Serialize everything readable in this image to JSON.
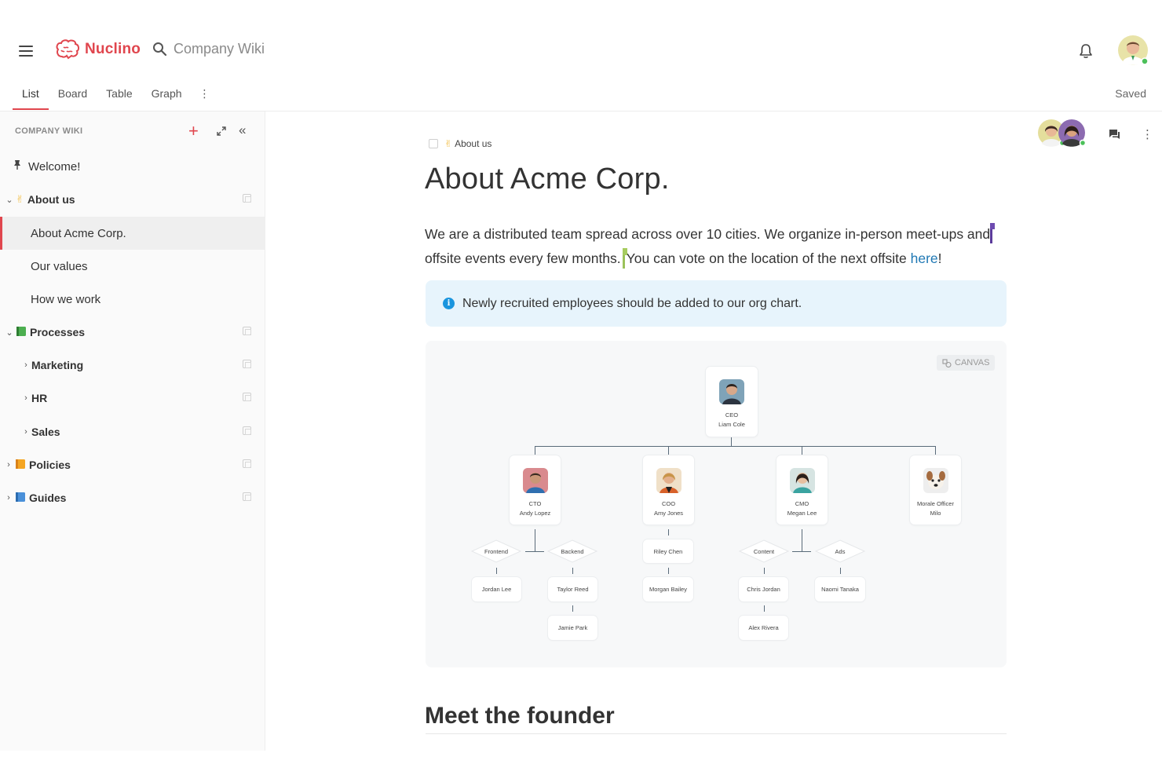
{
  "app": {
    "name": "Nuclino",
    "brand_color": "#e0464e"
  },
  "search": {
    "placeholder": "Company Wiki"
  },
  "tabs": [
    {
      "label": "List",
      "active": true
    },
    {
      "label": "Board",
      "active": false
    },
    {
      "label": "Table",
      "active": false
    },
    {
      "label": "Graph",
      "active": false
    }
  ],
  "tab_more": "⋮",
  "status": {
    "saved": "Saved"
  },
  "sidebar": {
    "header": "COMPANY WIKI",
    "items": [
      {
        "label": "Welcome!",
        "icon": "pin-icon"
      },
      {
        "label": "About us",
        "emoji": "✌",
        "expanded": true
      },
      {
        "label": "About Acme Corp.",
        "selected": true
      },
      {
        "label": "Our values"
      },
      {
        "label": "How we work"
      },
      {
        "label": "Processes",
        "emoji": "📗",
        "expanded": true
      },
      {
        "label": "Marketing"
      },
      {
        "label": "HR"
      },
      {
        "label": "Sales"
      },
      {
        "label": "Policies",
        "emoji": "📙"
      },
      {
        "label": "Guides",
        "emoji": "📘"
      }
    ]
  },
  "document": {
    "breadcrumb_emoji": "✌",
    "breadcrumb": "About us",
    "title": "About Acme Corp.",
    "paragraph": {
      "part1": "We are a distributed team spread across over 10 cities. We organize in-person meet-ups and",
      "part2": "offsite events every few months.",
      "part3": "You can vote on the location of the next offsite ",
      "link": "here",
      "part4": "!"
    },
    "callout": "Newly recruited employees should be added to our org chart.",
    "canvas_badge": "CANVAS",
    "h2": "Meet the founder"
  },
  "org_chart": {
    "ceo": {
      "role": "CEO",
      "name": "Liam Cole"
    },
    "execs": [
      {
        "role": "CTO",
        "name": "Andy Lopez"
      },
      {
        "role": "COO",
        "name": "Amy Jones"
      },
      {
        "role": "CMO",
        "name": "Megan Lee"
      },
      {
        "role": "Morale Officer",
        "name": "Milo"
      }
    ],
    "teams": {
      "frontend": "Frontend",
      "backend": "Backend",
      "content": "Content",
      "ads": "Ads"
    },
    "people": {
      "jordan_lee": "Jordan Lee",
      "taylor_reed": "Taylor Reed",
      "jamie_park": "Jamie Park",
      "riley_chen": "Riley Chen",
      "morgan_bailey": "Morgan Bailey",
      "chris_jordan": "Chris Jordan",
      "alex_rivera": "Alex Rivera",
      "naomi_tanaka": "Naomi Tanaka"
    }
  }
}
